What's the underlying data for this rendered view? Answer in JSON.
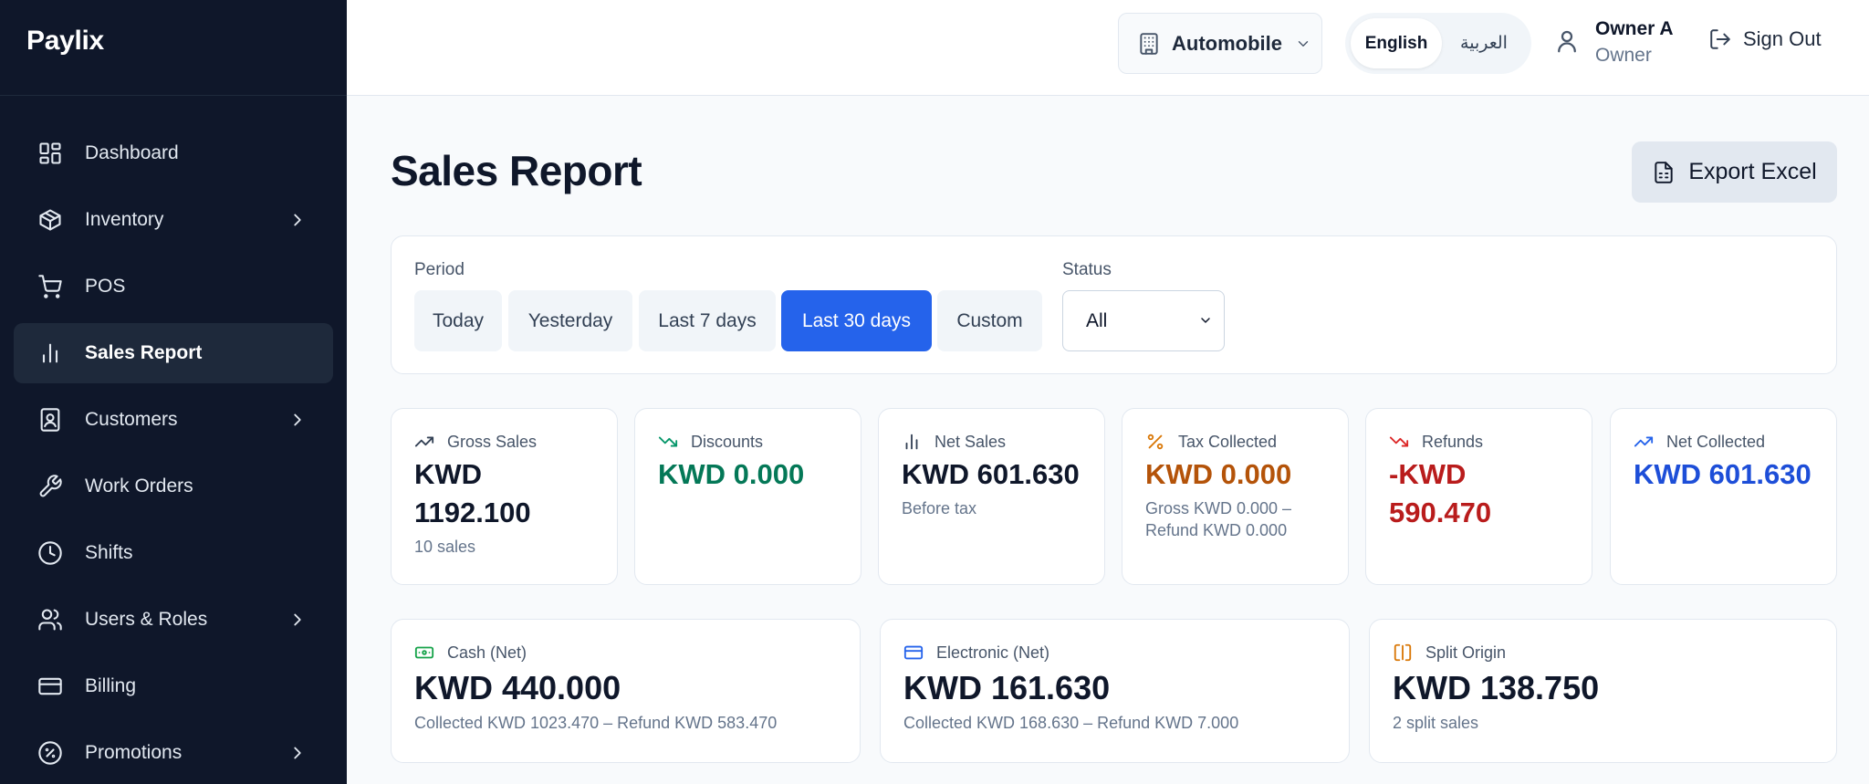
{
  "app": {
    "brand": "Paylix"
  },
  "sidebar": {
    "items": [
      {
        "label": "Dashboard",
        "icon": "dashboard-icon",
        "active": false,
        "expandable": false
      },
      {
        "label": "Inventory",
        "icon": "package-icon",
        "active": false,
        "expandable": true
      },
      {
        "label": "POS",
        "icon": "cart-icon",
        "active": false,
        "expandable": false
      },
      {
        "label": "Sales Report",
        "icon": "bar-chart-icon",
        "active": true,
        "expandable": false
      },
      {
        "label": "Customers",
        "icon": "contact-icon",
        "active": false,
        "expandable": true
      },
      {
        "label": "Work Orders",
        "icon": "wrench-icon",
        "active": false,
        "expandable": false
      },
      {
        "label": "Shifts",
        "icon": "clock-icon",
        "active": false,
        "expandable": false
      },
      {
        "label": "Users & Roles",
        "icon": "users-icon",
        "active": false,
        "expandable": true
      },
      {
        "label": "Billing",
        "icon": "credit-card-icon",
        "active": false,
        "expandable": false
      },
      {
        "label": "Promotions",
        "icon": "badge-percent-icon",
        "active": false,
        "expandable": true
      }
    ]
  },
  "topbar": {
    "branch": "Automobile",
    "languages": {
      "active": "English",
      "other": "العربية"
    },
    "user": {
      "name": "Owner A",
      "role": "Owner"
    },
    "sign_out": "Sign Out"
  },
  "page": {
    "title": "Sales Report",
    "export_label": "Export Excel"
  },
  "filters": {
    "period_label": "Period",
    "periods": [
      "Today",
      "Yesterday",
      "Last 7 days",
      "Last 30 days",
      "Custom"
    ],
    "selected_period": "Last 30 days",
    "status_label": "Status",
    "status_value": "All"
  },
  "metrics": {
    "gross_sales": {
      "label": "Gross Sales",
      "value": "KWD 1192.100",
      "sub": "10 sales",
      "color": "#0f172a"
    },
    "discounts": {
      "label": "Discounts",
      "value": "KWD 0.000",
      "sub": "",
      "color": "#047857"
    },
    "net_sales": {
      "label": "Net Sales",
      "value": "KWD 601.630",
      "sub": "Before tax",
      "color": "#0f172a"
    },
    "tax_collected": {
      "label": "Tax Collected",
      "value": "KWD 0.000",
      "sub": "Gross KWD 0.000 – Refund KWD 0.000",
      "color": "#b45309"
    },
    "refunds": {
      "label": "Refunds",
      "value": "-KWD 590.470",
      "sub": "",
      "color": "#b91c1c"
    },
    "net_collected": {
      "label": "Net Collected",
      "value": "KWD 601.630",
      "sub": "",
      "color": "#1d4ed8"
    },
    "cash_net": {
      "label": "Cash (Net)",
      "value": "KWD 440.000",
      "sub": "Collected KWD 1023.470 – Refund KWD 583.470",
      "color": "#0f172a"
    },
    "electronic_net": {
      "label": "Electronic (Net)",
      "value": "KWD 161.630",
      "sub": "Collected KWD 168.630 – Refund KWD 7.000",
      "color": "#0f172a"
    },
    "split_origin": {
      "label": "Split Origin",
      "value": "KWD 138.750",
      "sub": "2 split sales",
      "color": "#0f172a"
    }
  },
  "colors": {
    "sidebar_bg": "#0f172a",
    "accent": "#2563eb",
    "discount_green": "#047857",
    "tax_orange": "#b45309",
    "refund_red": "#b91c1c",
    "collected_blue": "#1d4ed8"
  }
}
